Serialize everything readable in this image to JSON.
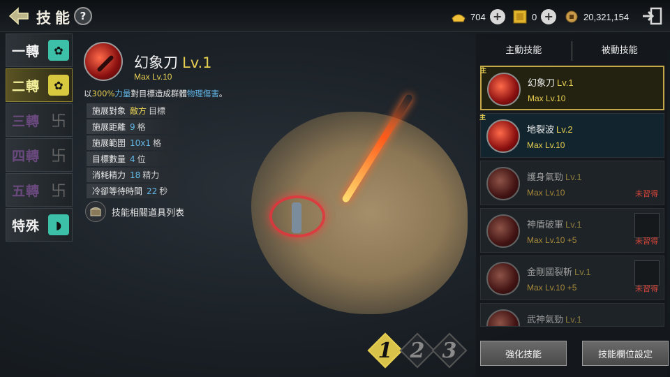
{
  "header": {
    "title": "技能",
    "help_label": "?",
    "currencies": [
      {
        "name": "gold-ingot-icon",
        "value": "704"
      },
      {
        "name": "token-icon",
        "value": "0"
      },
      {
        "name": "coin-icon",
        "value": "20,321,154"
      }
    ],
    "plus_label": "+"
  },
  "tabs": [
    {
      "label": "一轉",
      "state": "normal"
    },
    {
      "label": "二轉",
      "state": "active"
    },
    {
      "label": "三轉",
      "state": "locked"
    },
    {
      "label": "四轉",
      "state": "locked"
    },
    {
      "label": "五轉",
      "state": "locked"
    },
    {
      "label": "特殊",
      "state": "special"
    }
  ],
  "detail": {
    "name": "幻象刀",
    "level": "Lv.1",
    "max": "Max Lv.10",
    "desc_prefix": "以",
    "desc_pct": "300%",
    "desc_stat": "力量",
    "desc_mid": "對目標造成群體",
    "desc_type": "物理傷害",
    "desc_end": "。",
    "stats": [
      {
        "label": "施展對象",
        "value": "敵方",
        "unit": "目標",
        "enemy": true
      },
      {
        "label": "施展距離",
        "value": "9",
        "unit": "格"
      },
      {
        "label": "施展範圍",
        "value": "10x1",
        "unit": "格"
      },
      {
        "label": "目標數量",
        "value": "4",
        "unit": "位"
      },
      {
        "label": "消耗精力",
        "value": "18",
        "unit": "精力"
      },
      {
        "label": "冷卻等待時間",
        "value": "22",
        "unit": "秒"
      }
    ],
    "items_link": "技能相關道具列表"
  },
  "pages": [
    "1",
    "2",
    "3"
  ],
  "active_page": "1",
  "right": {
    "tab_active": "主動技能",
    "tab_passive": "被動技能",
    "skills": [
      {
        "name": "幻象刀",
        "level": "Lv.1",
        "max": "Max Lv.10",
        "state": "selected",
        "tag": "主",
        "status": ""
      },
      {
        "name": "地裂波",
        "level": "Lv.2",
        "max": "Max Lv.10",
        "state": "learned",
        "tag": "主",
        "status": ""
      },
      {
        "name": "護身氣勁",
        "level": "Lv.1",
        "max": "Max Lv.10",
        "state": "unlearned",
        "status": "未習得"
      },
      {
        "name": "神盾破軍",
        "level": "Lv.1",
        "max": "Max Lv.10 +5",
        "state": "unlearned",
        "status": "未習得"
      },
      {
        "name": "金剛國裂斬",
        "level": "Lv.1",
        "max": "Max Lv.10 +5",
        "state": "unlearned",
        "status": "未習得"
      },
      {
        "name": "武神氣勁",
        "level": "Lv.1",
        "max": "",
        "state": "unlearned",
        "status": ""
      }
    ],
    "btn_enhance": "強化技能",
    "btn_slot": "技能欄位設定"
  }
}
